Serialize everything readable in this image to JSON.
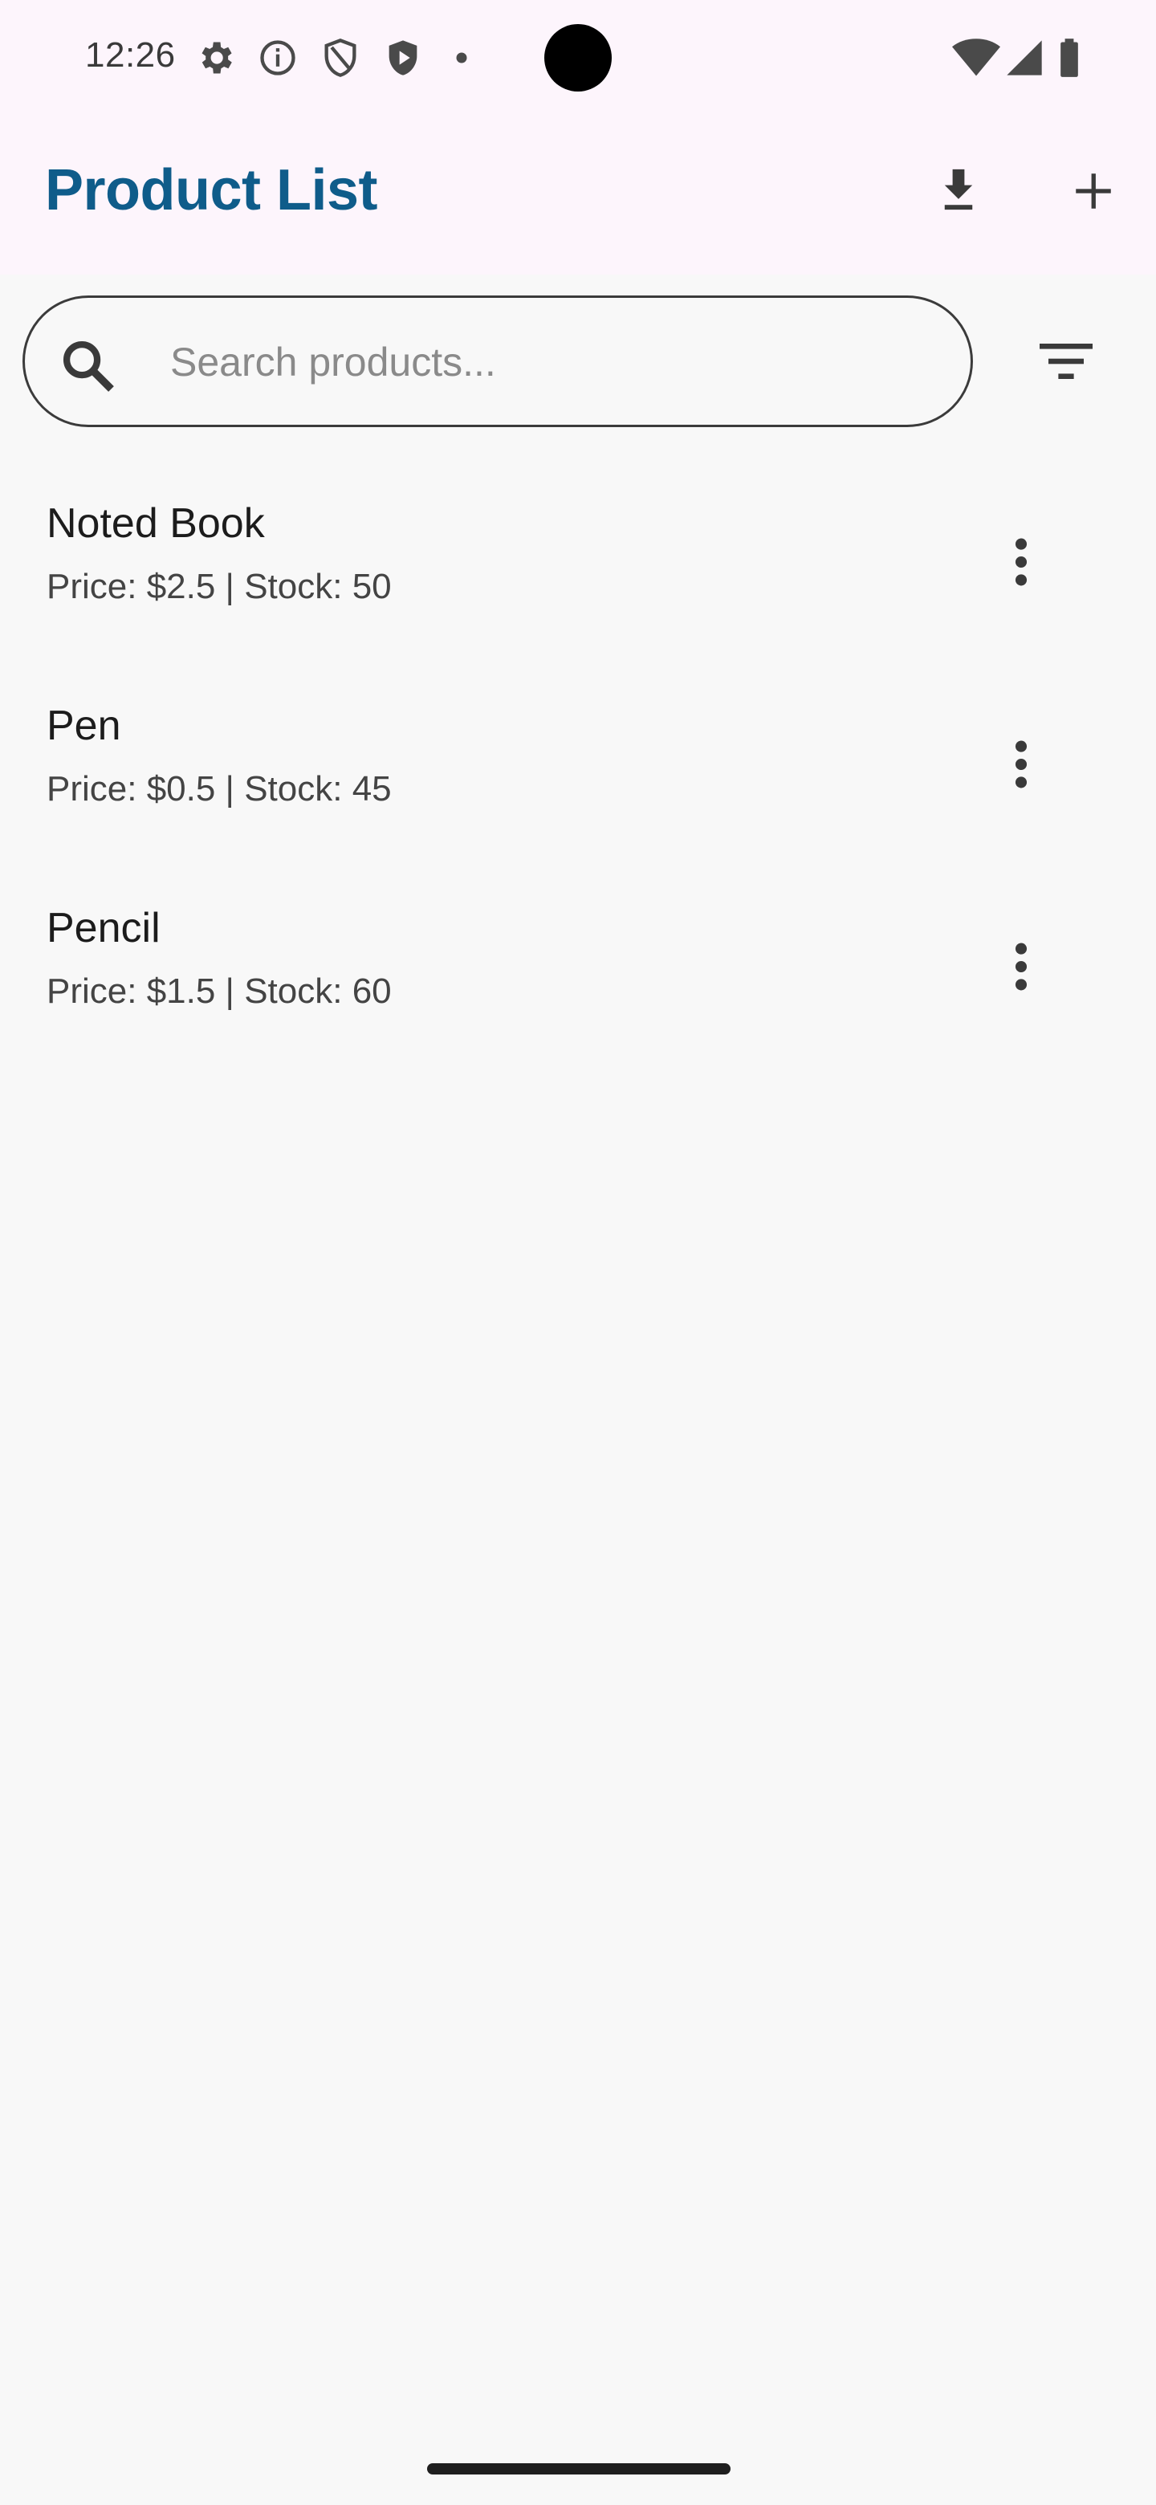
{
  "status_bar": {
    "time": "12:26",
    "icons_left": [
      "settings-icon",
      "info-icon",
      "shield-icon",
      "play-protect-icon",
      "dot-icon"
    ],
    "icons_right": [
      "wifi-icon",
      "cellular-icon",
      "battery-icon"
    ]
  },
  "app_bar": {
    "title": "Product List",
    "actions": [
      "download-icon",
      "add-icon"
    ],
    "title_color": "#0f5c8a",
    "background": "#fdf5fc"
  },
  "search": {
    "placeholder": "Search products...",
    "value": ""
  },
  "products": [
    {
      "name": "Noted Book",
      "meta": "Price: $2.5 | Stock: 50"
    },
    {
      "name": "Pen",
      "meta": "Price: $0.5 | Stock: 45"
    },
    {
      "name": "Pencil",
      "meta": "Price: $1.5 | Stock: 60"
    }
  ]
}
